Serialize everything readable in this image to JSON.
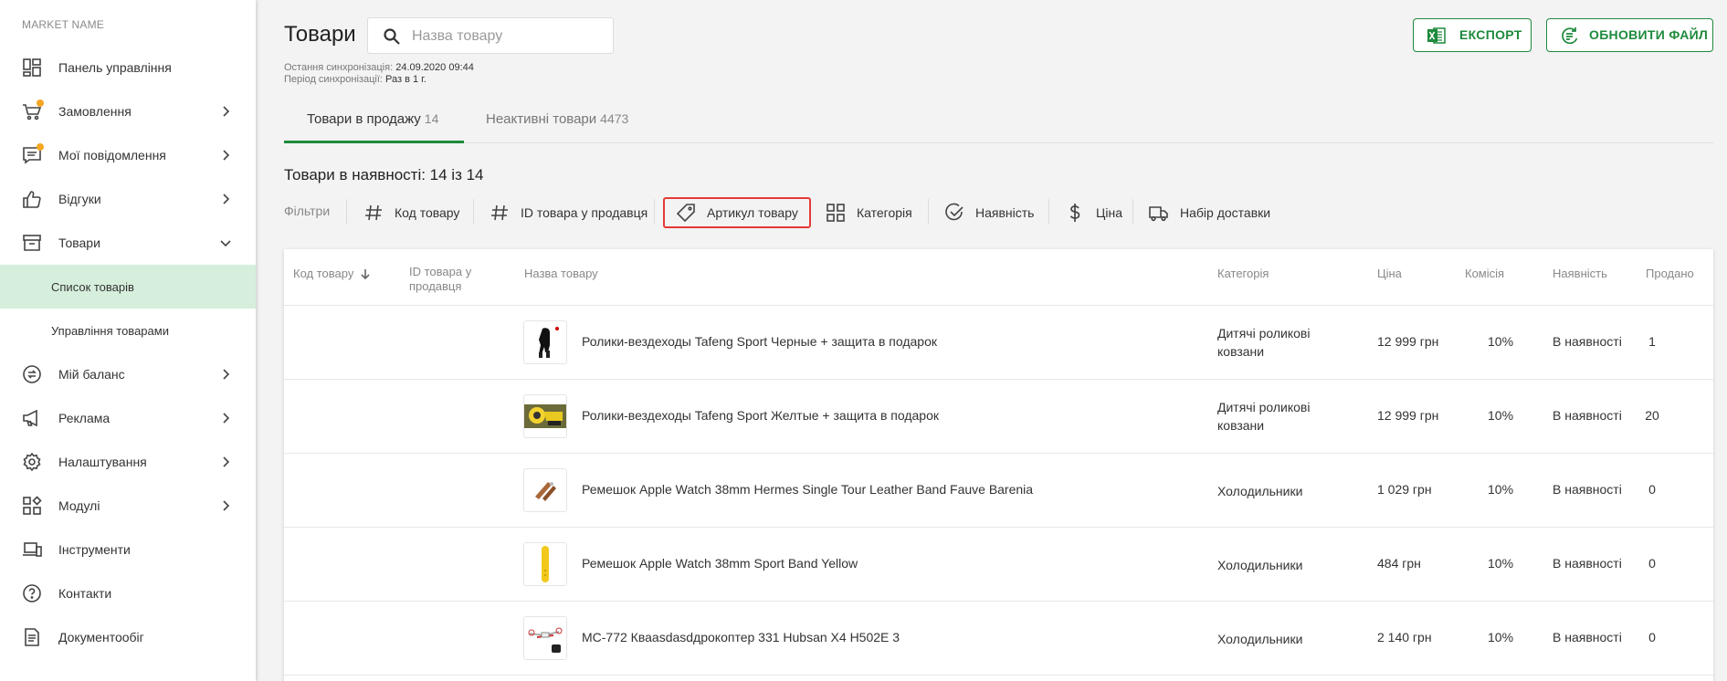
{
  "sidebar": {
    "market_name": "MARKET NAME",
    "items": [
      {
        "label": "Панель управління",
        "icon": "dashboard-icon"
      },
      {
        "label": "Замовлення",
        "icon": "cart-icon"
      },
      {
        "label": "Мої повідомлення",
        "icon": "messages-icon"
      },
      {
        "label": "Відгуки",
        "icon": "thumbs-up-icon"
      },
      {
        "label": "Товари",
        "icon": "box-icon"
      },
      {
        "label": "Список товарів"
      },
      {
        "label": "Управління товарами"
      },
      {
        "label": "Мій баланс",
        "icon": "balance-icon"
      },
      {
        "label": "Реклама",
        "icon": "megaphone-icon"
      },
      {
        "label": "Налаштування",
        "icon": "gear-icon"
      },
      {
        "label": "Модулі",
        "icon": "modules-icon"
      },
      {
        "label": "Інструменти",
        "icon": "devices-icon"
      },
      {
        "label": "Контакти",
        "icon": "help-circle-icon"
      },
      {
        "label": "Документообіг",
        "icon": "document-icon"
      }
    ]
  },
  "header": {
    "title": "Товари",
    "search_placeholder": "Назва товару",
    "sync_last_label": "Остання синхронізація:",
    "sync_last_value": "24.09.2020 09:44",
    "sync_period_label": "Період синхронізації:",
    "sync_period_value": "Раз в 1 г.",
    "export_label": "ЕКСПОРТ",
    "update_label": "ОБНОВИТИ ФАЙЛ"
  },
  "tabs": [
    {
      "label": "Товари в продажу",
      "count": "14"
    },
    {
      "label": "Неактивні товари",
      "count": "4473"
    }
  ],
  "in_stock_text": "Товари в наявності: 14 із 14",
  "filters": {
    "label": "Фільтри",
    "items": [
      {
        "label": "Код товару",
        "icon": "hash-icon"
      },
      {
        "label": "ID товара у продавця",
        "icon": "hash-icon"
      },
      {
        "label": "Артикул товару",
        "icon": "tag-icon"
      },
      {
        "label": "Категорія",
        "icon": "grid-icon"
      },
      {
        "label": "Наявність",
        "icon": "check-circle-icon"
      },
      {
        "label": "Ціна",
        "icon": "dollar-icon"
      },
      {
        "label": "Набір доставки",
        "icon": "truck-icon"
      }
    ]
  },
  "table": {
    "columns": {
      "code": "Код товару",
      "seller_id_1": "ID товара у",
      "seller_id_2": "продавця",
      "name": "Назва товару",
      "category": "Категорія",
      "price": "Ціна",
      "commission": "Комісія",
      "availability": "Наявність",
      "sold": "Продано"
    },
    "rows": [
      {
        "name": "Ролики-вездеходы Tafeng Sport Черные + защита в подарок",
        "category": "Дитячі роликові ковзани",
        "price": "12 999 грн",
        "commission": "10%",
        "availability": "В наявності",
        "sold": "1"
      },
      {
        "name": "Ролики-вездеходы Tafeng Sport Желтые + защита в подарок",
        "category": "Дитячі роликові ковзани",
        "price": "12 999 грн",
        "commission": "10%",
        "availability": "В наявності",
        "sold": "20"
      },
      {
        "name": "Ремешок Apple Watch 38mm Hermes Single Tour Leather Band Fauve Barenia",
        "category": "Холодильники",
        "price": "1 029 грн",
        "commission": "10%",
        "availability": "В наявності",
        "sold": "0"
      },
      {
        "name": "Ремешок Apple Watch 38mm Sport Band Yellow",
        "category": "Холодильники",
        "price": "484 грн",
        "commission": "10%",
        "availability": "В наявності",
        "sold": "0"
      },
      {
        "name": "MC-772 Кваasdasdдрокоптер 331 Hubsan X4 H502E 3",
        "category": "Холодильники",
        "price": "2 140 грн",
        "commission": "10%",
        "availability": "В наявності",
        "sold": "0"
      }
    ]
  },
  "colors": {
    "accent": "#1e8a3c",
    "highlight": "#e53935",
    "badge": "#f5a623",
    "active_bg": "#d6efdc"
  }
}
